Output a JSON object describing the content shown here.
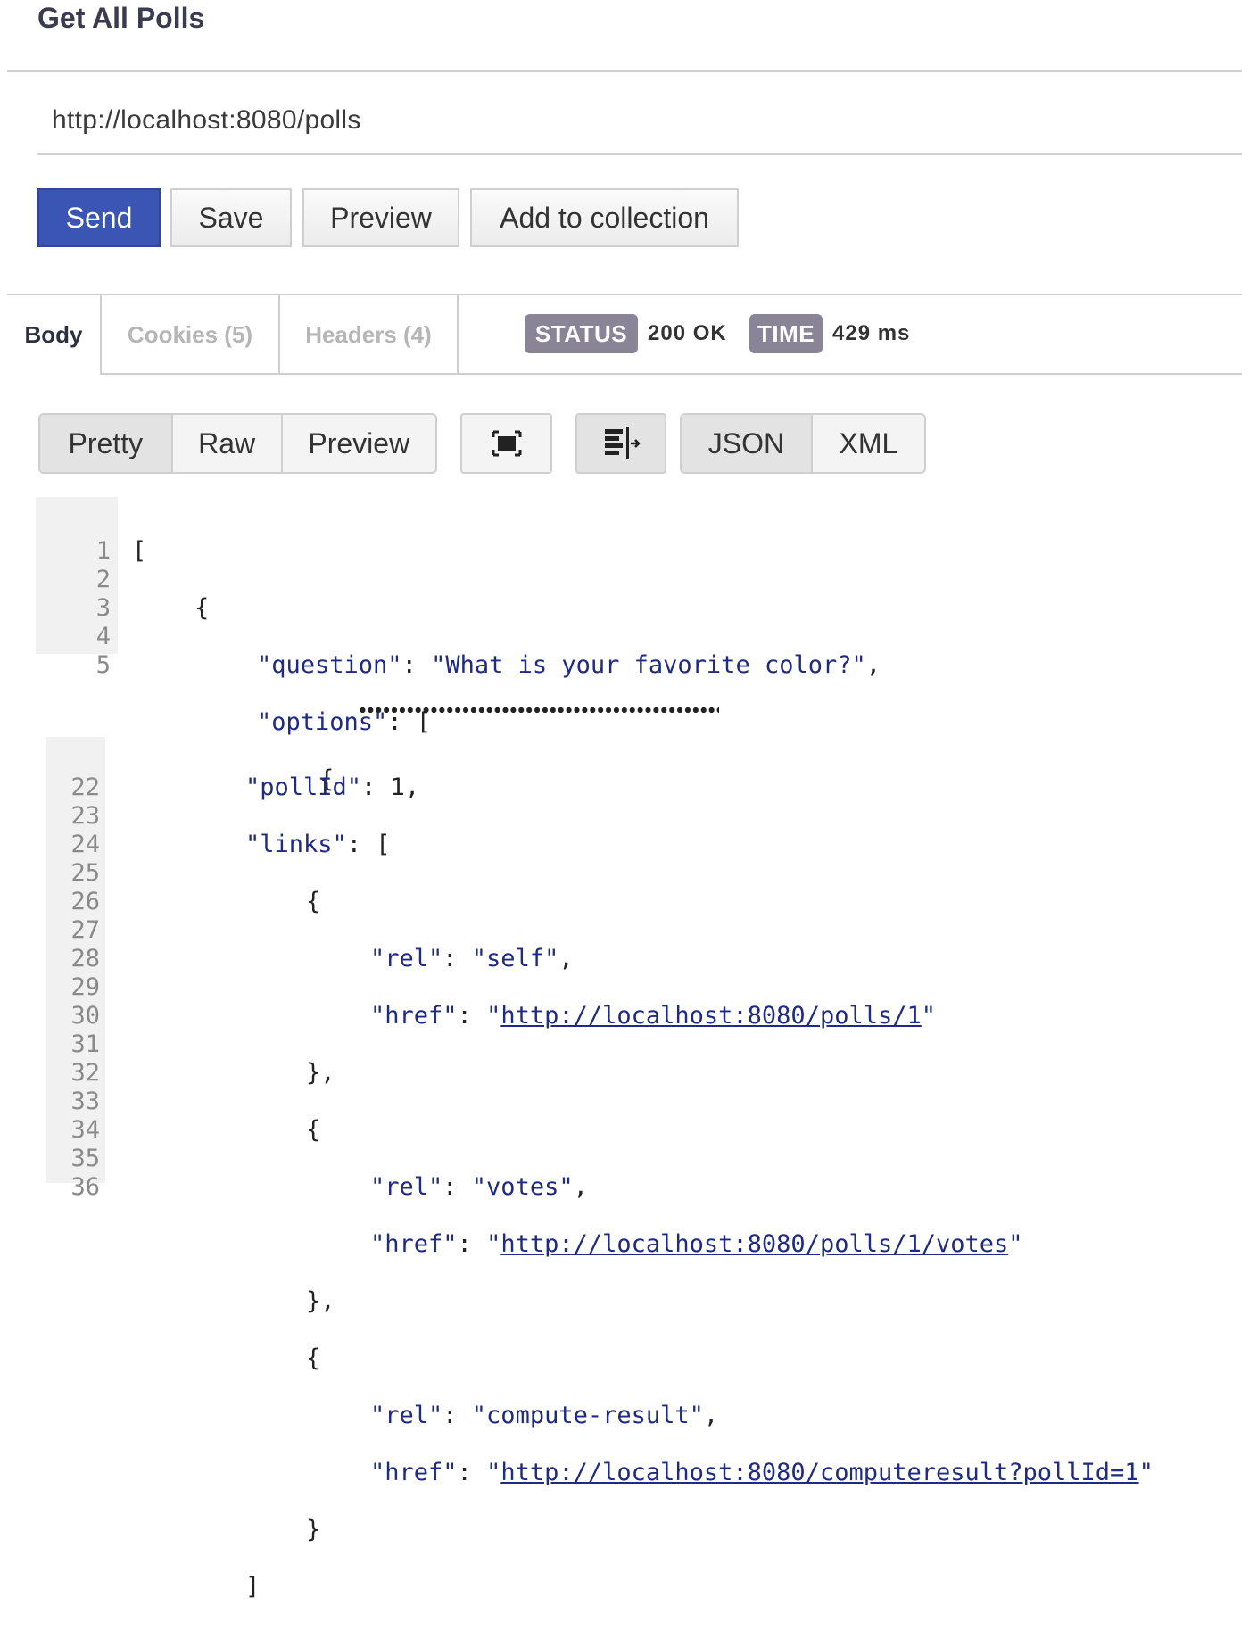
{
  "request": {
    "title": "Get All Polls",
    "url": "http://localhost:8080/polls",
    "buttons": {
      "send": "Send",
      "save": "Save",
      "preview": "Preview",
      "add": "Add to collection"
    }
  },
  "response": {
    "tabs": {
      "body": "Body",
      "cookies": "Cookies (5)",
      "headers": "Headers (4)"
    },
    "status_label": "STATUS",
    "status_value": "200 OK",
    "time_label": "TIME",
    "time_value": "429 ms",
    "view_modes": {
      "pretty": "Pretty",
      "raw": "Raw",
      "preview": "Preview"
    },
    "icons": {
      "fullscreen": "fullscreen-icon",
      "wrap": "wrap-lines-icon"
    },
    "formats": {
      "json": "JSON",
      "xml": "XML"
    }
  },
  "code_top": {
    "line_numbers": [
      "1",
      "2",
      "3",
      "4",
      "5"
    ],
    "l1": "[",
    "l2": "{",
    "l3_key": "\"question\"",
    "l3_sep": ": ",
    "l3_val": "\"What is your favorite color?\"",
    "l3_end": ",",
    "l4_key": "\"options\"",
    "l4_rest": ": [",
    "l5": "{"
  },
  "code_bottom": {
    "line_numbers": [
      "22",
      "23",
      "24",
      "25",
      "26",
      "27",
      "28",
      "29",
      "30",
      "31",
      "32",
      "33",
      "34",
      "35",
      "36"
    ],
    "l22_key": "\"pollId\"",
    "l22_rest": ": 1,",
    "l23_key": "\"links\"",
    "l23_rest": ": [",
    "open_brace": "{",
    "close_comma": "},",
    "close": "}",
    "close_bracket": "]",
    "rel_key": "\"rel\"",
    "href_key": "\"href\"",
    "sep": ": ",
    "comma": ",",
    "quote": "\"",
    "links": [
      {
        "rel": "\"self\"",
        "href": "http://localhost:8080/polls/1"
      },
      {
        "rel": "\"votes\"",
        "href": "http://localhost:8080/polls/1/votes"
      },
      {
        "rel": "\"compute-result\"",
        "href": "http://localhost:8080/computeresult?pollId=1"
      }
    ]
  }
}
